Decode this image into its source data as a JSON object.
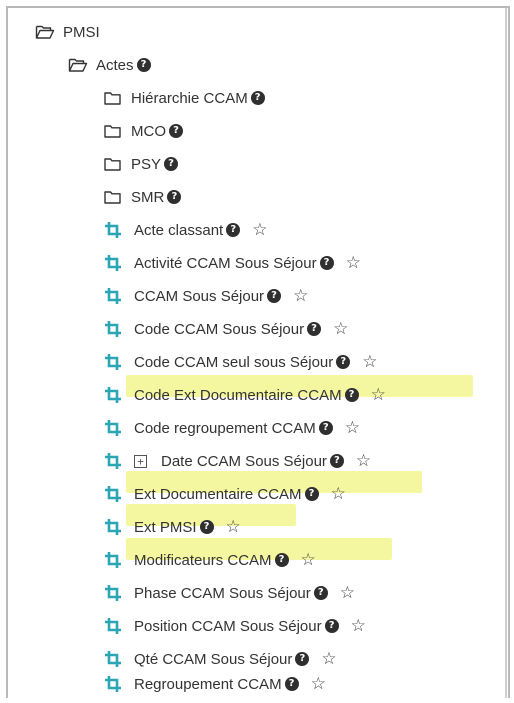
{
  "tree": {
    "root": {
      "label": "PMSI"
    },
    "actes": {
      "label": "Actes"
    },
    "folders": [
      {
        "label": "Hiérarchie CCAM"
      },
      {
        "label": "MCO"
      },
      {
        "label": "PSY"
      },
      {
        "label": "SMR"
      }
    ],
    "items": [
      {
        "label": "Acte classant"
      },
      {
        "label": "Activité CCAM Sous Séjour"
      },
      {
        "label": "CCAM Sous Séjour"
      },
      {
        "label": "Code CCAM Sous Séjour"
      },
      {
        "label": "Code CCAM seul sous Séjour"
      },
      {
        "label": "Code Ext Documentaire CCAM"
      },
      {
        "label": "Code regroupement CCAM"
      },
      {
        "label": "Date CCAM Sous Séjour"
      },
      {
        "label": "Ext Documentaire CCAM"
      },
      {
        "label": "Ext PMSI"
      },
      {
        "label": "Modificateurs CCAM"
      },
      {
        "label": "Phase CCAM Sous Séjour"
      },
      {
        "label": "Position CCAM Sous Séjour"
      },
      {
        "label": "Qté CCAM Sous Séjour"
      },
      {
        "label": "Regroupement CCAM"
      }
    ]
  },
  "symbols": {
    "help": "?",
    "star": "☆",
    "expand": "+"
  },
  "colors": {
    "crop_icon": "#2aa6b4",
    "highlight": "#f4f7a0"
  }
}
